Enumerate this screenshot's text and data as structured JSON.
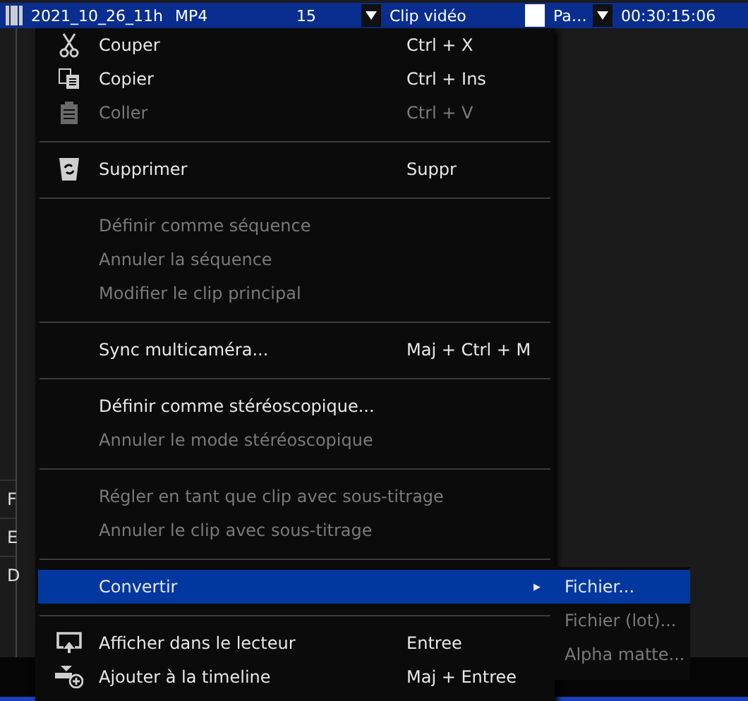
{
  "file_list": {
    "selected_row": {
      "name": "2021_10_26_11h",
      "format": "MP4",
      "frame_rate": "15",
      "type": "Clip vidéo",
      "column_5": "Pa…",
      "duration": "00:30:15:06"
    },
    "hidden_rows": [
      "F",
      "E",
      "D"
    ]
  },
  "context_menu": {
    "items": [
      {
        "kind": "item",
        "label": "Couper",
        "shortcut": "Ctrl + X",
        "disabled": false,
        "selected": false
      },
      {
        "kind": "item",
        "label": "Copier",
        "shortcut": "Ctrl + Ins",
        "disabled": false,
        "selected": false
      },
      {
        "kind": "item",
        "label": "Coller",
        "shortcut": "Ctrl + V",
        "disabled": true,
        "selected": false
      },
      {
        "kind": "separator"
      },
      {
        "kind": "item",
        "label": "Supprimer",
        "shortcut": "Suppr",
        "disabled": false,
        "selected": false
      },
      {
        "kind": "separator"
      },
      {
        "kind": "item",
        "label": "Définir comme séquence",
        "disabled": true,
        "selected": false
      },
      {
        "kind": "item",
        "label": "Annuler la séquence",
        "disabled": true,
        "selected": false
      },
      {
        "kind": "item",
        "label": "Modifier le clip principal",
        "disabled": true,
        "selected": false
      },
      {
        "kind": "separator"
      },
      {
        "kind": "item",
        "label": "Sync multicaméra...",
        "shortcut": "Maj + Ctrl + M",
        "disabled": false,
        "selected": false
      },
      {
        "kind": "separator"
      },
      {
        "kind": "item",
        "label": "Définir comme stéréoscopique...",
        "disabled": false,
        "selected": false
      },
      {
        "kind": "item",
        "label": "Annuler le mode stéréoscopique",
        "disabled": true,
        "selected": false
      },
      {
        "kind": "separator"
      },
      {
        "kind": "item",
        "label": "Régler en tant que clip avec sous-titrage",
        "disabled": true,
        "selected": false
      },
      {
        "kind": "item",
        "label": "Annuler le clip avec sous-titrage",
        "disabled": true,
        "selected": false
      },
      {
        "kind": "separator"
      },
      {
        "kind": "item",
        "label": "Convertir",
        "disabled": false,
        "selected": true,
        "submenu_arrow": "▸"
      },
      {
        "kind": "separator"
      },
      {
        "kind": "item",
        "label": "Afficher dans le lecteur",
        "shortcut": "Entree",
        "disabled": false,
        "selected": false
      },
      {
        "kind": "item",
        "label": "Ajouter à la timeline",
        "shortcut": "Maj + Entree",
        "disabled": false,
        "selected": false
      }
    ]
  },
  "submenu": {
    "items": [
      {
        "label": "Fichier...",
        "disabled": false,
        "selected": true
      },
      {
        "label": "Fichier (lot)...",
        "disabled": true,
        "selected": false
      },
      {
        "label": "Alpha matte...",
        "disabled": true,
        "selected": false
      }
    ]
  }
}
